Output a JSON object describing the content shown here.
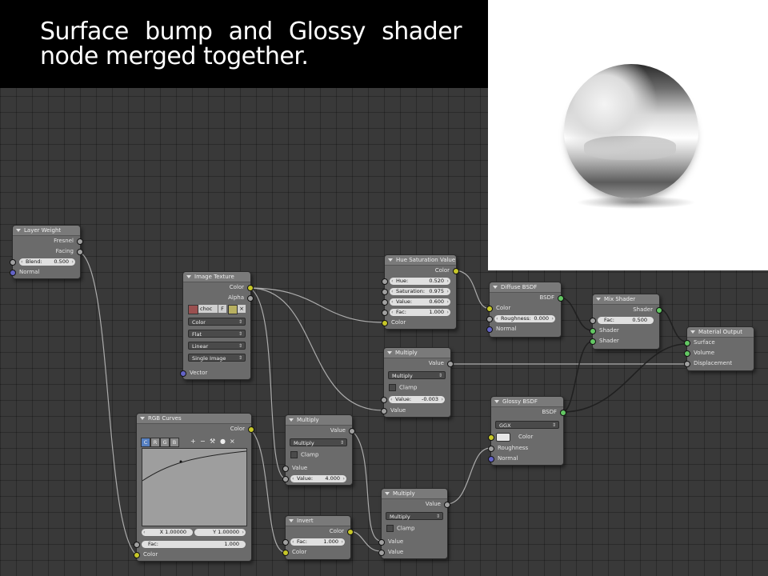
{
  "caption": "Surface bump and Glossy shader node merged together.",
  "nodes": {
    "layer_weight": {
      "title": "Layer Weight",
      "fresnel": "Fresnel",
      "facing": "Facing",
      "blend_label": "Blend:",
      "blend_value": "0.500",
      "normal": "Normal"
    },
    "image_texture": {
      "title": "Image Texture",
      "color": "Color",
      "alpha": "Alpha",
      "image_name": "choc",
      "f_btn": "F",
      "dd_color": "Color",
      "dd_flat": "Flat",
      "dd_linear": "Linear",
      "dd_single": "Single Image",
      "vector": "Vector"
    },
    "hue_sat": {
      "title": "Hue Saturation Value",
      "color_out": "Color",
      "hue_label": "Hue:",
      "hue_value": "0.520",
      "sat_label": "Saturation:",
      "sat_value": "0.975",
      "val_label": "Value:",
      "val_value": "0.600",
      "fac_label": "Fac:",
      "fac_value": "1.000",
      "color_in": "Color"
    },
    "diffuse": {
      "title": "Diffuse BSDF",
      "bsdf": "BSDF",
      "color": "Color",
      "rough_label": "Roughness:",
      "rough_value": "0.000",
      "normal": "Normal"
    },
    "mix_shader": {
      "title": "Mix Shader",
      "shader_out": "Shader",
      "fac_label": "Fac:",
      "fac_value": "0.500",
      "shader1": "Shader",
      "shader2": "Shader"
    },
    "material_output": {
      "title": "Material Output",
      "surface": "Surface",
      "volume": "Volume",
      "displacement": "Displacement"
    },
    "multiply_top": {
      "title": "Multiply",
      "value_out": "Value",
      "mode": "Multiply",
      "clamp": "Clamp",
      "value_label": "Value:",
      "value_value": "-0.003",
      "value_in": "Value"
    },
    "glossy": {
      "title": "Glossy BSDF",
      "bsdf": "BSDF",
      "dist": "GGX",
      "color": "Color",
      "roughness": "Roughness",
      "normal": "Normal"
    },
    "rgb_curves": {
      "title": "RGB Curves",
      "color_out": "Color",
      "tabs": [
        "C",
        "R",
        "G",
        "B"
      ],
      "tools": [
        "+",
        "−",
        "⚒",
        "●",
        "×"
      ],
      "x_label": "X 1.00000",
      "y_label": "Y 1.00000",
      "fac_label": "Fac:",
      "fac_value": "1.000",
      "color_in": "Color"
    },
    "multiply_mid": {
      "title": "Multiply",
      "value_out": "Value",
      "mode": "Multiply",
      "clamp": "Clamp",
      "value_in": "Value",
      "value_label": "Value:",
      "value_value": "4.000"
    },
    "invert": {
      "title": "Invert",
      "color_out": "Color",
      "fac_label": "Fac:",
      "fac_value": "1.000",
      "color_in": "Color"
    },
    "multiply_bot": {
      "title": "Multiply",
      "value_out": "Value",
      "mode": "Multiply",
      "clamp": "Clamp",
      "value_in1": "Value",
      "value_in2": "Value"
    }
  },
  "socket_colors": {
    "gray": "#a1a1a1",
    "yellow": "#c7c729",
    "blue": "#6363c7",
    "green": "#63c763"
  }
}
